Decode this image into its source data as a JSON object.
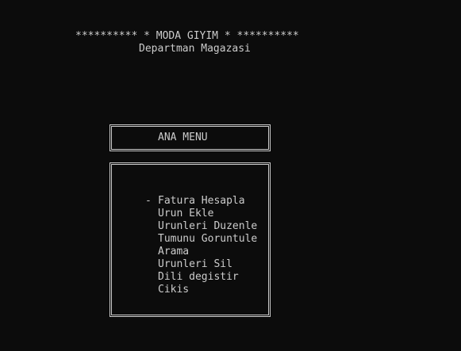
{
  "header": {
    "title": "********** * MODA GIYIM * **********",
    "subtitle": "Departman Magazasi"
  },
  "menu": {
    "heading": "ANA MENU",
    "selected_marker": "-",
    "items": [
      {
        "label": "Fatura Hesapla",
        "selected": true
      },
      {
        "label": "Urun Ekle",
        "selected": false
      },
      {
        "label": "Urunleri Duzenle",
        "selected": false
      },
      {
        "label": "Tumunu Goruntule",
        "selected": false
      },
      {
        "label": "Arama",
        "selected": false
      },
      {
        "label": "Urunleri Sil",
        "selected": false
      },
      {
        "label": "Dili degistir",
        "selected": false
      },
      {
        "label": "Cikis",
        "selected": false
      }
    ]
  }
}
